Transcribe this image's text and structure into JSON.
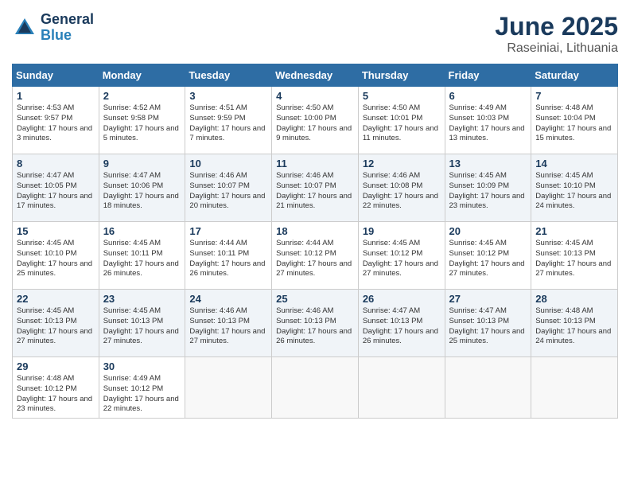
{
  "header": {
    "logo_line1": "General",
    "logo_line2": "Blue",
    "month": "June 2025",
    "location": "Raseiniai, Lithuania"
  },
  "weekdays": [
    "Sunday",
    "Monday",
    "Tuesday",
    "Wednesday",
    "Thursday",
    "Friday",
    "Saturday"
  ],
  "weeks": [
    [
      {
        "day": "1",
        "sunrise": "4:53 AM",
        "sunset": "9:57 PM",
        "daylight": "17 hours and 3 minutes."
      },
      {
        "day": "2",
        "sunrise": "4:52 AM",
        "sunset": "9:58 PM",
        "daylight": "17 hours and 5 minutes."
      },
      {
        "day": "3",
        "sunrise": "4:51 AM",
        "sunset": "9:59 PM",
        "daylight": "17 hours and 7 minutes."
      },
      {
        "day": "4",
        "sunrise": "4:50 AM",
        "sunset": "10:00 PM",
        "daylight": "17 hours and 9 minutes."
      },
      {
        "day": "5",
        "sunrise": "4:50 AM",
        "sunset": "10:01 PM",
        "daylight": "17 hours and 11 minutes."
      },
      {
        "day": "6",
        "sunrise": "4:49 AM",
        "sunset": "10:03 PM",
        "daylight": "17 hours and 13 minutes."
      },
      {
        "day": "7",
        "sunrise": "4:48 AM",
        "sunset": "10:04 PM",
        "daylight": "17 hours and 15 minutes."
      }
    ],
    [
      {
        "day": "8",
        "sunrise": "4:47 AM",
        "sunset": "10:05 PM",
        "daylight": "17 hours and 17 minutes."
      },
      {
        "day": "9",
        "sunrise": "4:47 AM",
        "sunset": "10:06 PM",
        "daylight": "17 hours and 18 minutes."
      },
      {
        "day": "10",
        "sunrise": "4:46 AM",
        "sunset": "10:07 PM",
        "daylight": "17 hours and 20 minutes."
      },
      {
        "day": "11",
        "sunrise": "4:46 AM",
        "sunset": "10:07 PM",
        "daylight": "17 hours and 21 minutes."
      },
      {
        "day": "12",
        "sunrise": "4:46 AM",
        "sunset": "10:08 PM",
        "daylight": "17 hours and 22 minutes."
      },
      {
        "day": "13",
        "sunrise": "4:45 AM",
        "sunset": "10:09 PM",
        "daylight": "17 hours and 23 minutes."
      },
      {
        "day": "14",
        "sunrise": "4:45 AM",
        "sunset": "10:10 PM",
        "daylight": "17 hours and 24 minutes."
      }
    ],
    [
      {
        "day": "15",
        "sunrise": "4:45 AM",
        "sunset": "10:10 PM",
        "daylight": "17 hours and 25 minutes."
      },
      {
        "day": "16",
        "sunrise": "4:45 AM",
        "sunset": "10:11 PM",
        "daylight": "17 hours and 26 minutes."
      },
      {
        "day": "17",
        "sunrise": "4:44 AM",
        "sunset": "10:11 PM",
        "daylight": "17 hours and 26 minutes."
      },
      {
        "day": "18",
        "sunrise": "4:44 AM",
        "sunset": "10:12 PM",
        "daylight": "17 hours and 27 minutes."
      },
      {
        "day": "19",
        "sunrise": "4:45 AM",
        "sunset": "10:12 PM",
        "daylight": "17 hours and 27 minutes."
      },
      {
        "day": "20",
        "sunrise": "4:45 AM",
        "sunset": "10:12 PM",
        "daylight": "17 hours and 27 minutes."
      },
      {
        "day": "21",
        "sunrise": "4:45 AM",
        "sunset": "10:13 PM",
        "daylight": "17 hours and 27 minutes."
      }
    ],
    [
      {
        "day": "22",
        "sunrise": "4:45 AM",
        "sunset": "10:13 PM",
        "daylight": "17 hours and 27 minutes."
      },
      {
        "day": "23",
        "sunrise": "4:45 AM",
        "sunset": "10:13 PM",
        "daylight": "17 hours and 27 minutes."
      },
      {
        "day": "24",
        "sunrise": "4:46 AM",
        "sunset": "10:13 PM",
        "daylight": "17 hours and 27 minutes."
      },
      {
        "day": "25",
        "sunrise": "4:46 AM",
        "sunset": "10:13 PM",
        "daylight": "17 hours and 26 minutes."
      },
      {
        "day": "26",
        "sunrise": "4:47 AM",
        "sunset": "10:13 PM",
        "daylight": "17 hours and 26 minutes."
      },
      {
        "day": "27",
        "sunrise": "4:47 AM",
        "sunset": "10:13 PM",
        "daylight": "17 hours and 25 minutes."
      },
      {
        "day": "28",
        "sunrise": "4:48 AM",
        "sunset": "10:13 PM",
        "daylight": "17 hours and 24 minutes."
      }
    ],
    [
      {
        "day": "29",
        "sunrise": "4:48 AM",
        "sunset": "10:12 PM",
        "daylight": "17 hours and 23 minutes."
      },
      {
        "day": "30",
        "sunrise": "4:49 AM",
        "sunset": "10:12 PM",
        "daylight": "17 hours and 22 minutes."
      },
      null,
      null,
      null,
      null,
      null
    ]
  ]
}
